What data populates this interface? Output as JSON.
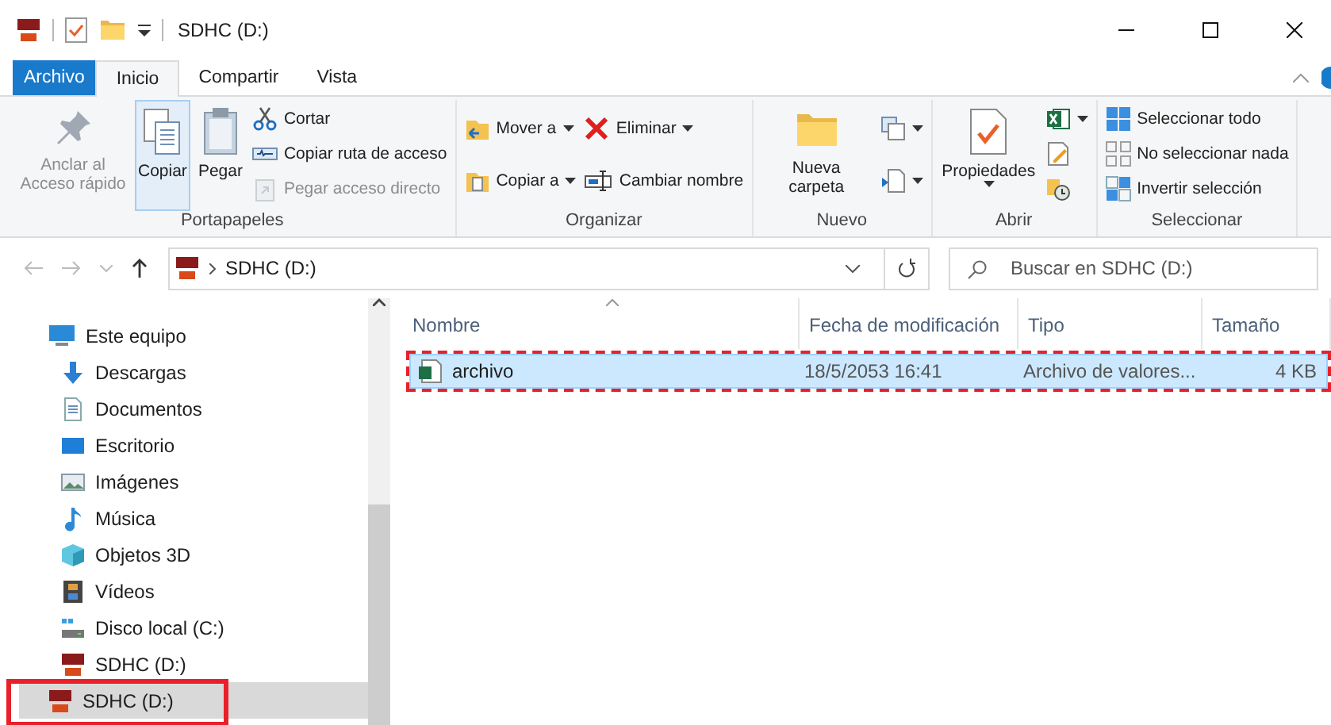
{
  "window": {
    "title": "SDHC (D:)"
  },
  "tabs": [
    {
      "label": "Archivo",
      "kind": "file",
      "selected": false
    },
    {
      "label": "Inicio",
      "kind": "tab",
      "selected": true
    },
    {
      "label": "Compartir",
      "kind": "tab",
      "selected": false
    },
    {
      "label": "Vista",
      "kind": "tab",
      "selected": false
    }
  ],
  "ribbon": {
    "groups": [
      {
        "label": "Portapapeles",
        "large": [
          {
            "label": "Anclar al Acceso rápido",
            "disabled": true,
            "highlighted": false
          },
          {
            "label": "Copiar",
            "disabled": false,
            "highlighted": true
          },
          {
            "label": "Pegar",
            "disabled": false,
            "highlighted": false
          }
        ],
        "columns": [
          [
            {
              "label": "Cortar",
              "disabled": false,
              "dropdown": false
            },
            {
              "label": "Copiar ruta de acceso",
              "disabled": false,
              "dropdown": false
            },
            {
              "label": "Pegar acceso directo",
              "disabled": true,
              "dropdown": false
            }
          ]
        ]
      },
      {
        "label": "Organizar",
        "columns": [
          [
            {
              "label": "Mover a",
              "disabled": false,
              "dropdown": true
            },
            {
              "label": "Copiar a",
              "disabled": false,
              "dropdown": true
            }
          ],
          [
            {
              "label": "Eliminar",
              "disabled": false,
              "dropdown": true
            },
            {
              "label": "Cambiar nombre",
              "disabled": false,
              "dropdown": false
            }
          ]
        ]
      },
      {
        "label": "Nuevo",
        "large": [
          {
            "label": "Nueva carpeta",
            "disabled": false,
            "highlighted": false
          }
        ],
        "columns": [
          [
            {
              "disabled": false,
              "dropdown": true
            },
            {
              "disabled": false,
              "dropdown": true
            }
          ]
        ]
      },
      {
        "label": "Abrir",
        "large": [
          {
            "label": "Propiedades",
            "disabled": false,
            "highlighted": false,
            "dropdown": true
          }
        ],
        "columns": [
          [
            {
              "disabled": false,
              "dropdown": true
            },
            {
              "disabled": false,
              "dropdown": false
            },
            {
              "disabled": false,
              "dropdown": false
            }
          ]
        ]
      },
      {
        "label": "Seleccionar",
        "columns": [
          [
            {
              "label": "Seleccionar todo",
              "disabled": false,
              "dropdown": false
            },
            {
              "label": "No seleccionar nada",
              "disabled": false,
              "dropdown": false
            },
            {
              "label": "Invertir selección",
              "disabled": false,
              "dropdown": false
            }
          ]
        ]
      }
    ]
  },
  "address": {
    "path": "SDHC (D:)"
  },
  "search": {
    "placeholder": "Buscar en SDHC (D:)"
  },
  "sidebar": {
    "items": [
      {
        "label": "Este equipo",
        "selected": false,
        "children": [
          {
            "label": "Descargas",
            "selected": false
          },
          {
            "label": "Documentos",
            "selected": false
          },
          {
            "label": "Escritorio",
            "selected": false
          },
          {
            "label": "Imágenes",
            "selected": false
          },
          {
            "label": "Música",
            "selected": false
          },
          {
            "label": "Objetos 3D",
            "selected": false
          },
          {
            "label": "Vídeos",
            "selected": false
          },
          {
            "label": "Disco local (C:)",
            "selected": false
          },
          {
            "label": "SDHC (D:)",
            "selected": false
          }
        ]
      },
      {
        "label": "SDHC (D:)",
        "selected": true
      }
    ]
  },
  "table": {
    "columns": [
      "Nombre",
      "Fecha de modificación",
      "Tipo",
      "Tamaño"
    ],
    "rows": [
      {
        "cells": [
          "archivo",
          "18/5/2053 16:41",
          "Archivo de valores...",
          "4 KB"
        ],
        "selected": true
      }
    ]
  }
}
